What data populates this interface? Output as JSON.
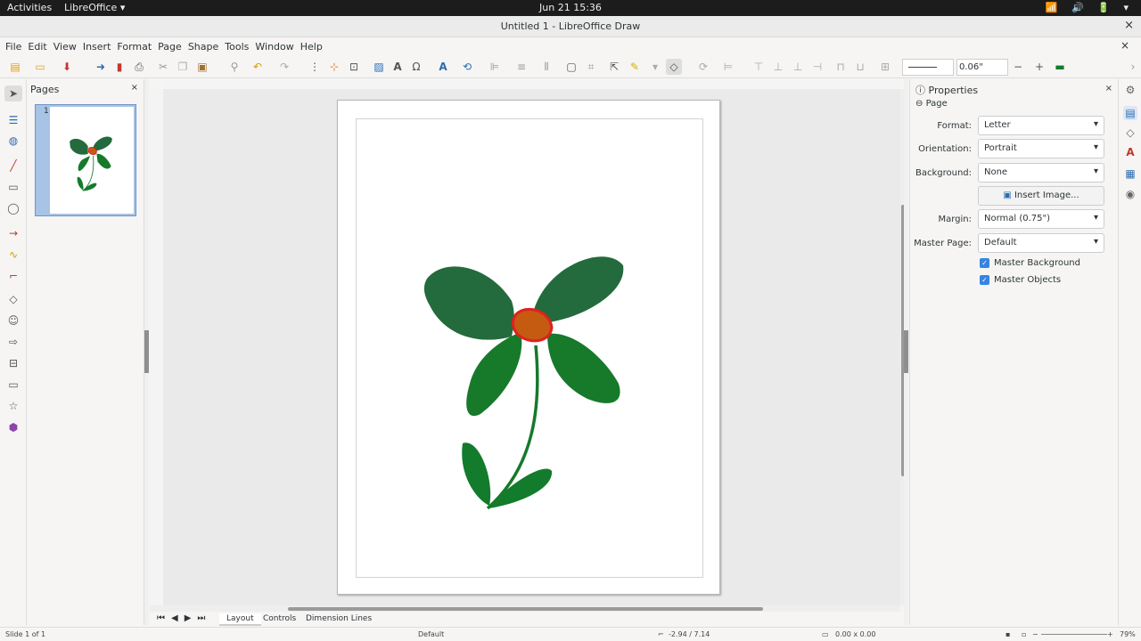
{
  "topbar": {
    "activities": "Activities",
    "app_name": "LibreOffice ▾",
    "clock": "Jun 21  15:36",
    "tray": "📶 🔊 🔋 ▾"
  },
  "window": {
    "title": "Untitled 1 - LibreOffice Draw",
    "close": "×"
  },
  "menu": {
    "items": [
      "File",
      "Edit",
      "View",
      "Insert",
      "Format",
      "Page",
      "Shape",
      "Tools",
      "Window",
      "Help"
    ],
    "close": "×"
  },
  "toolbar": {
    "line_width": "0.06\"",
    "minus": "−",
    "plus": "+"
  },
  "pages_panel": {
    "title": "Pages",
    "close": "×",
    "page_number": "1"
  },
  "tabs": {
    "nav": "⏮◀▶⏭",
    "layout": "Layout",
    "controls": "Controls",
    "dimension_lines": "Dimension Lines"
  },
  "properties": {
    "title": "Properties",
    "close": "×",
    "section": "Page",
    "format_label": "Format:",
    "format_value": "Letter",
    "orientation_label": "Orientation:",
    "orientation_value": "Portrait",
    "background_label": "Background:",
    "background_value": "None",
    "insert_image": "Insert Image...",
    "margin_label": "Margin:",
    "margin_value": "Normal (0.75\")",
    "master_page_label": "Master Page:",
    "master_page_value": "Default",
    "master_background": "Master Background",
    "master_objects": "Master Objects"
  },
  "status": {
    "slide": "Slide 1 of 1",
    "master": "Default",
    "position": "-2.94 / 7.14",
    "size": "0.00 x 0.00",
    "zoom": "79%"
  },
  "colors": {
    "petal_dark": "#236b3c",
    "petal": "#17792a",
    "leaf": "#137b2c",
    "center_fill": "#c55a11",
    "center_stroke": "#e02020"
  }
}
